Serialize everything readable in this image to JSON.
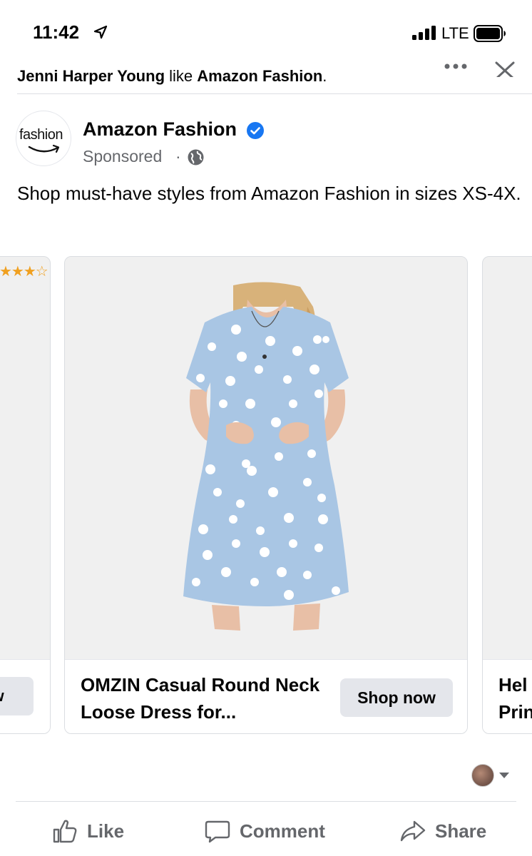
{
  "status_bar": {
    "time": "11:42",
    "carrier": "LTE"
  },
  "social_context": {
    "name": "Jenni Harper Young",
    "verb": "like",
    "page": "Amazon Fashion",
    "end": "."
  },
  "post": {
    "avatar_text": "fashion",
    "page_name": "Amazon Fashion",
    "sponsored_label": "Sponsored",
    "separator": "·",
    "text": "Shop must-have styles from Amazon Fashion in sizes XS-4X."
  },
  "carousel": {
    "left_card": {
      "rating_stars": "★★★☆",
      "button_label": "ow"
    },
    "main_card": {
      "title": "OMZIN Casual Round Neck Loose Dress for...",
      "button_label": "Shop now",
      "image_colors": {
        "dress": "#a9c6e4",
        "dots": "#ffffff",
        "skin": "#e8bfa6",
        "hair": "#d8b27a"
      }
    },
    "right_card": {
      "title_line1": "Hel",
      "title_line2": "Prin"
    }
  },
  "actions": {
    "like": "Like",
    "comment": "Comment",
    "share": "Share"
  },
  "colors": {
    "verified": "#1877f2",
    "secondary_text": "#65676b",
    "button_bg": "#e4e6eb",
    "card_bg": "#f0f0f0"
  }
}
